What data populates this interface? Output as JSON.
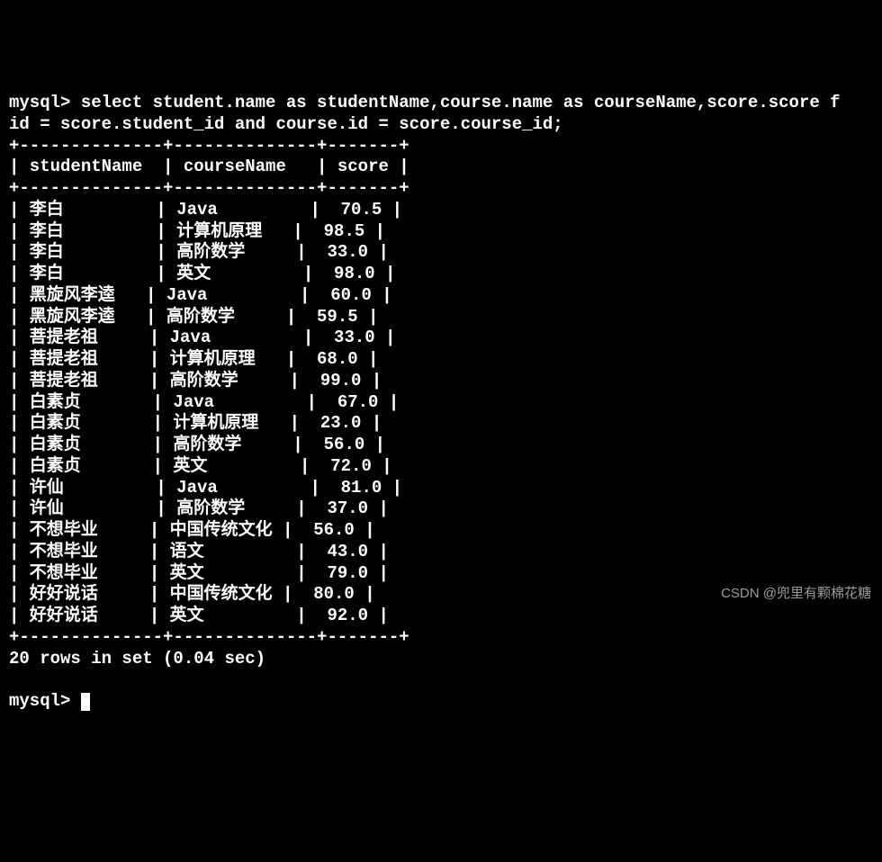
{
  "prompt": "mysql>",
  "query_line1": "mysql> select student.name as studentName,course.name as courseName,score.score f",
  "query_line2": "id = score.student_id and course.id = score.course_id;",
  "separator": "+--------------+--------------+-------+",
  "header_row": "| studentName  | courseName   | score |",
  "chart_data": {
    "type": "table",
    "columns": [
      "studentName",
      "courseName",
      "score"
    ],
    "rows": [
      {
        "studentName": "李白",
        "courseName": "Java",
        "score": 70.5
      },
      {
        "studentName": "李白",
        "courseName": "计算机原理",
        "score": 98.5
      },
      {
        "studentName": "李白",
        "courseName": "高阶数学",
        "score": 33.0
      },
      {
        "studentName": "李白",
        "courseName": "英文",
        "score": 98.0
      },
      {
        "studentName": "黑旋风李逵",
        "courseName": "Java",
        "score": 60.0
      },
      {
        "studentName": "黑旋风李逵",
        "courseName": "高阶数学",
        "score": 59.5
      },
      {
        "studentName": "菩提老祖",
        "courseName": "Java",
        "score": 33.0
      },
      {
        "studentName": "菩提老祖",
        "courseName": "计算机原理",
        "score": 68.0
      },
      {
        "studentName": "菩提老祖",
        "courseName": "高阶数学",
        "score": 99.0
      },
      {
        "studentName": "白素贞",
        "courseName": "Java",
        "score": 67.0
      },
      {
        "studentName": "白素贞",
        "courseName": "计算机原理",
        "score": 23.0
      },
      {
        "studentName": "白素贞",
        "courseName": "高阶数学",
        "score": 56.0
      },
      {
        "studentName": "白素贞",
        "courseName": "英文",
        "score": 72.0
      },
      {
        "studentName": "许仙",
        "courseName": "Java",
        "score": 81.0
      },
      {
        "studentName": "许仙",
        "courseName": "高阶数学",
        "score": 37.0
      },
      {
        "studentName": "不想毕业",
        "courseName": "中国传统文化",
        "score": 56.0
      },
      {
        "studentName": "不想毕业",
        "courseName": "语文",
        "score": 43.0
      },
      {
        "studentName": "不想毕业",
        "courseName": "英文",
        "score": 79.0
      },
      {
        "studentName": "好好说话",
        "courseName": "中国传统文化",
        "score": 80.0
      },
      {
        "studentName": "好好说话",
        "courseName": "英文",
        "score": 92.0
      }
    ]
  },
  "row_lines": [
    "| 李白         | Java         |  70.5 |",
    "| 李白         | 计算机原理   |  98.5 |",
    "| 李白         | 高阶数学     |  33.0 |",
    "| 李白         | 英文         |  98.0 |",
    "| 黑旋风李逵   | Java         |  60.0 |",
    "| 黑旋风李逵   | 高阶数学     |  59.5 |",
    "| 菩提老祖     | Java         |  33.0 |",
    "| 菩提老祖     | 计算机原理   |  68.0 |",
    "| 菩提老祖     | 高阶数学     |  99.0 |",
    "| 白素贞       | Java         |  67.0 |",
    "| 白素贞       | 计算机原理   |  23.0 |",
    "| 白素贞       | 高阶数学     |  56.0 |",
    "| 白素贞       | 英文         |  72.0 |",
    "| 许仙         | Java         |  81.0 |",
    "| 许仙         | 高阶数学     |  37.0 |",
    "| 不想毕业     | 中国传统文化 |  56.0 |",
    "| 不想毕业     | 语文         |  43.0 |",
    "| 不想毕业     | 英文         |  79.0 |",
    "| 好好说话     | 中国传统文化 |  80.0 |",
    "| 好好说话     | 英文         |  92.0 |"
  ],
  "summary": "20 rows in set (0.04 sec)",
  "next_prompt": "mysql> ",
  "watermark": "CSDN @兜里有颗棉花糖"
}
